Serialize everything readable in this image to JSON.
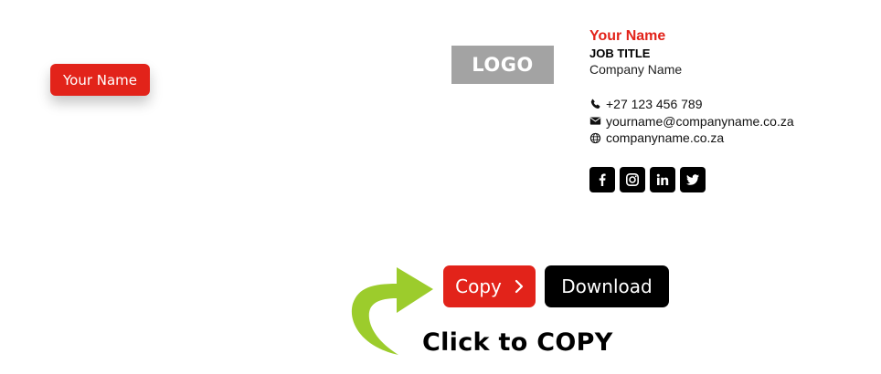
{
  "name_button": {
    "label": "Your Name"
  },
  "logo": {
    "text": "LOGO"
  },
  "signature": {
    "name": "Your Name",
    "job_title": "JOB TITLE",
    "company": "Company Name",
    "phone": "+27 123 456 789",
    "email": "yourname@companyname.co.za",
    "website": "companyname.co.za",
    "accent_color": "#e2231a"
  },
  "social": [
    {
      "name": "facebook",
      "icon": "facebook-icon"
    },
    {
      "name": "instagram",
      "icon": "instagram-icon"
    },
    {
      "name": "linkedin",
      "icon": "linkedin-icon"
    },
    {
      "name": "twitter",
      "icon": "twitter-icon"
    }
  ],
  "actions": {
    "copy_label": "Copy",
    "download_label": "Download",
    "hint": "Click to COPY",
    "arrow_color": "#9ccc2c"
  }
}
